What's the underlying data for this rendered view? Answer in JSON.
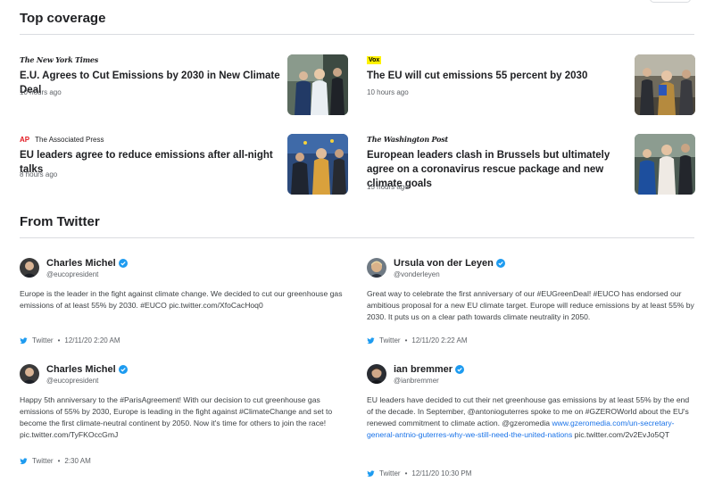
{
  "sections": {
    "top_coverage": "Top coverage",
    "from_twitter": "From Twitter"
  },
  "stories": [
    {
      "source": "The New York Times",
      "headline": "E.U. Agrees to Cut Emissions by 2030 in New Climate Deal",
      "time": "10 hours ago"
    },
    {
      "source": "Vox",
      "headline": "The EU will cut emissions 55 percent by 2030",
      "time": "10 hours ago"
    },
    {
      "source_badge": "AP",
      "source": "The Associated Press",
      "headline": "EU leaders agree to reduce emissions after all-night talks",
      "time": "8 hours ago"
    },
    {
      "source": "The Washington Post",
      "headline": "European leaders clash in Brussels but ultimately agree on a coronavirus rescue package and new climate goals",
      "time": "15 hours ago"
    }
  ],
  "tweets": [
    {
      "name": "Charles Michel",
      "handle": "@eucopresident",
      "text": "Europe is the leader in the fight against climate change. We decided to cut our greenhouse gas emissions of at least 55% by 2030. #EUCO",
      "link": "pic.twitter.com/XfoCacHoq0",
      "platform": "Twitter",
      "time": "12/11/20 2:20 AM"
    },
    {
      "name": "Ursula von der Leyen",
      "handle": "@vonderleyen",
      "text": "Great way to celebrate the first anniversary of our #EUGreenDeal! #EUCO has endorsed our ambitious proposal for a new EU climate target. Europe will reduce emissions by at least 55% by 2030. It puts us on a clear path towards climate neutrality in 2050.",
      "platform": "Twitter",
      "time": "12/11/20 2:22 AM"
    },
    {
      "name": "Charles Michel",
      "handle": "@eucopresident",
      "text": "Happy 5th anniversary to the #ParisAgreement! With our decision to cut greenhouse gas emissions of 55% by 2030, Europe is leading in the fight against #ClimateChange and set to become the first climate-neutral continent by 2050. Now it's time for others to join the race! pic.twitter.com/TyFKOccGmJ",
      "platform": "Twitter",
      "time": "2:30 AM"
    },
    {
      "name": "ian bremmer",
      "handle": "@ianbremmer",
      "text": "EU leaders have decided to cut their net greenhouse gas emissions by at least 55% by the end of the decade. In September, @antonioguterres spoke to me on #GZEROWorld about the EU's renewed commitment to climate action. @gzeromedia",
      "link": "www.gzeromedia.com/un-secretary-general-antnio-guterres-why-we-still-need-the-united-nations",
      "link2": "pic.twitter.com/2v2EvJo5QT",
      "platform": "Twitter",
      "time": "12/11/20 10:30 PM"
    }
  ],
  "colors": {
    "verified": "#1d9bf0",
    "twitter": "#1d9bf0",
    "link": "#1a73e8",
    "ap_red": "#e31b23",
    "vox_yellow": "#fff200"
  }
}
